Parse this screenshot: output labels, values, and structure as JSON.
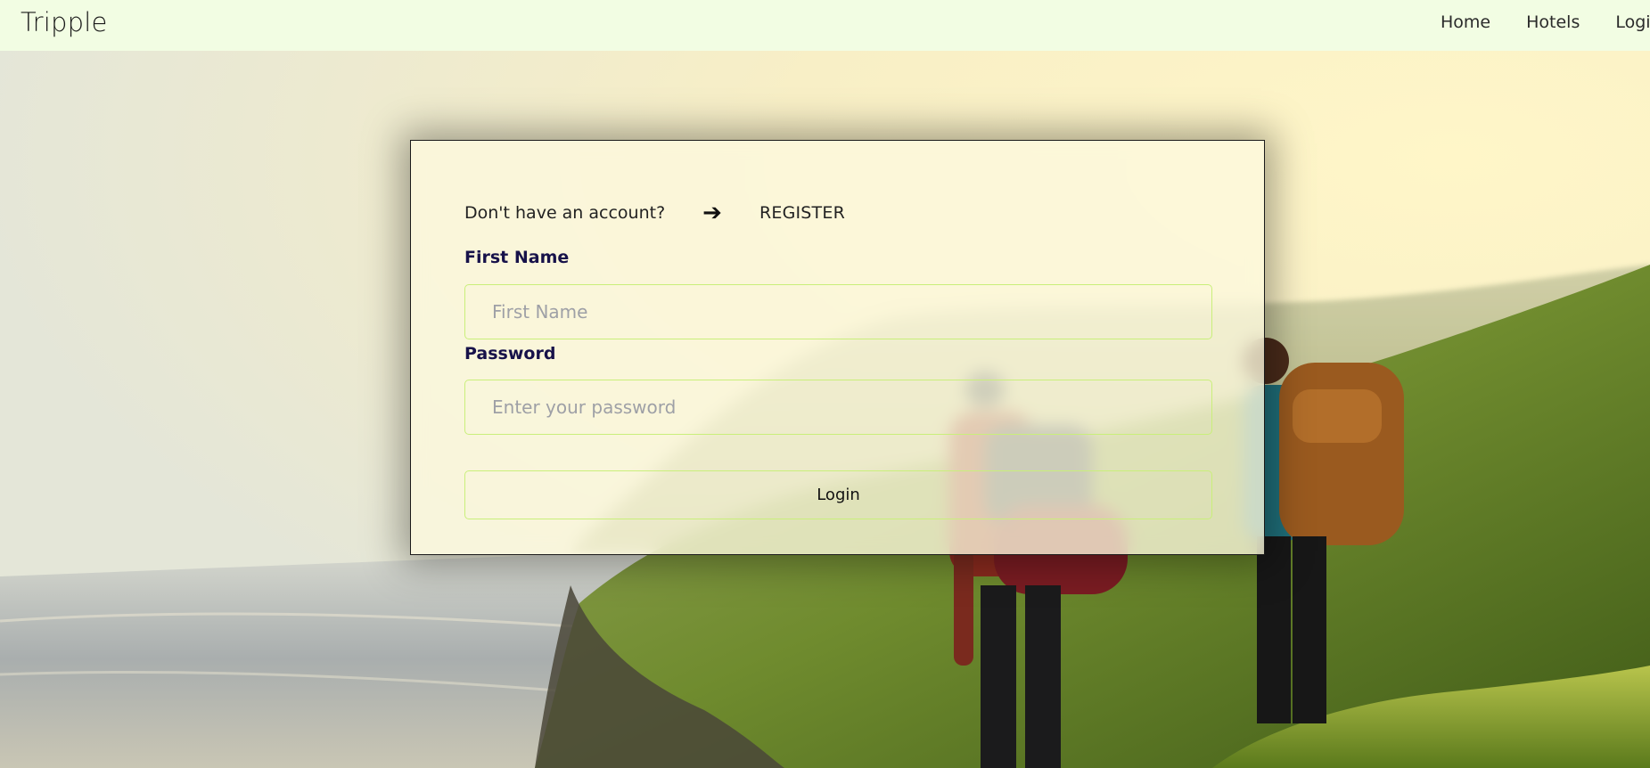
{
  "navbar": {
    "brand": "Tripple",
    "links": [
      {
        "label": "Home"
      },
      {
        "label": "Hotels"
      },
      {
        "label": "Login"
      }
    ]
  },
  "login_form": {
    "register_prompt": "Don't have an account?",
    "arrow_icon": "right-arrow-icon",
    "arrow_glyph": "➔",
    "register_link": "REGISTER",
    "first_name": {
      "label": "First Name",
      "value": "",
      "placeholder": "First Name"
    },
    "password": {
      "label": "Password",
      "value": "",
      "placeholder": "Enter your password"
    },
    "submit_label": "Login"
  },
  "colors": {
    "navbar_bg": "#f2fde3",
    "label_color": "#17124a",
    "input_border": "#c9ef7a",
    "placeholder": "#9ea0a6"
  }
}
